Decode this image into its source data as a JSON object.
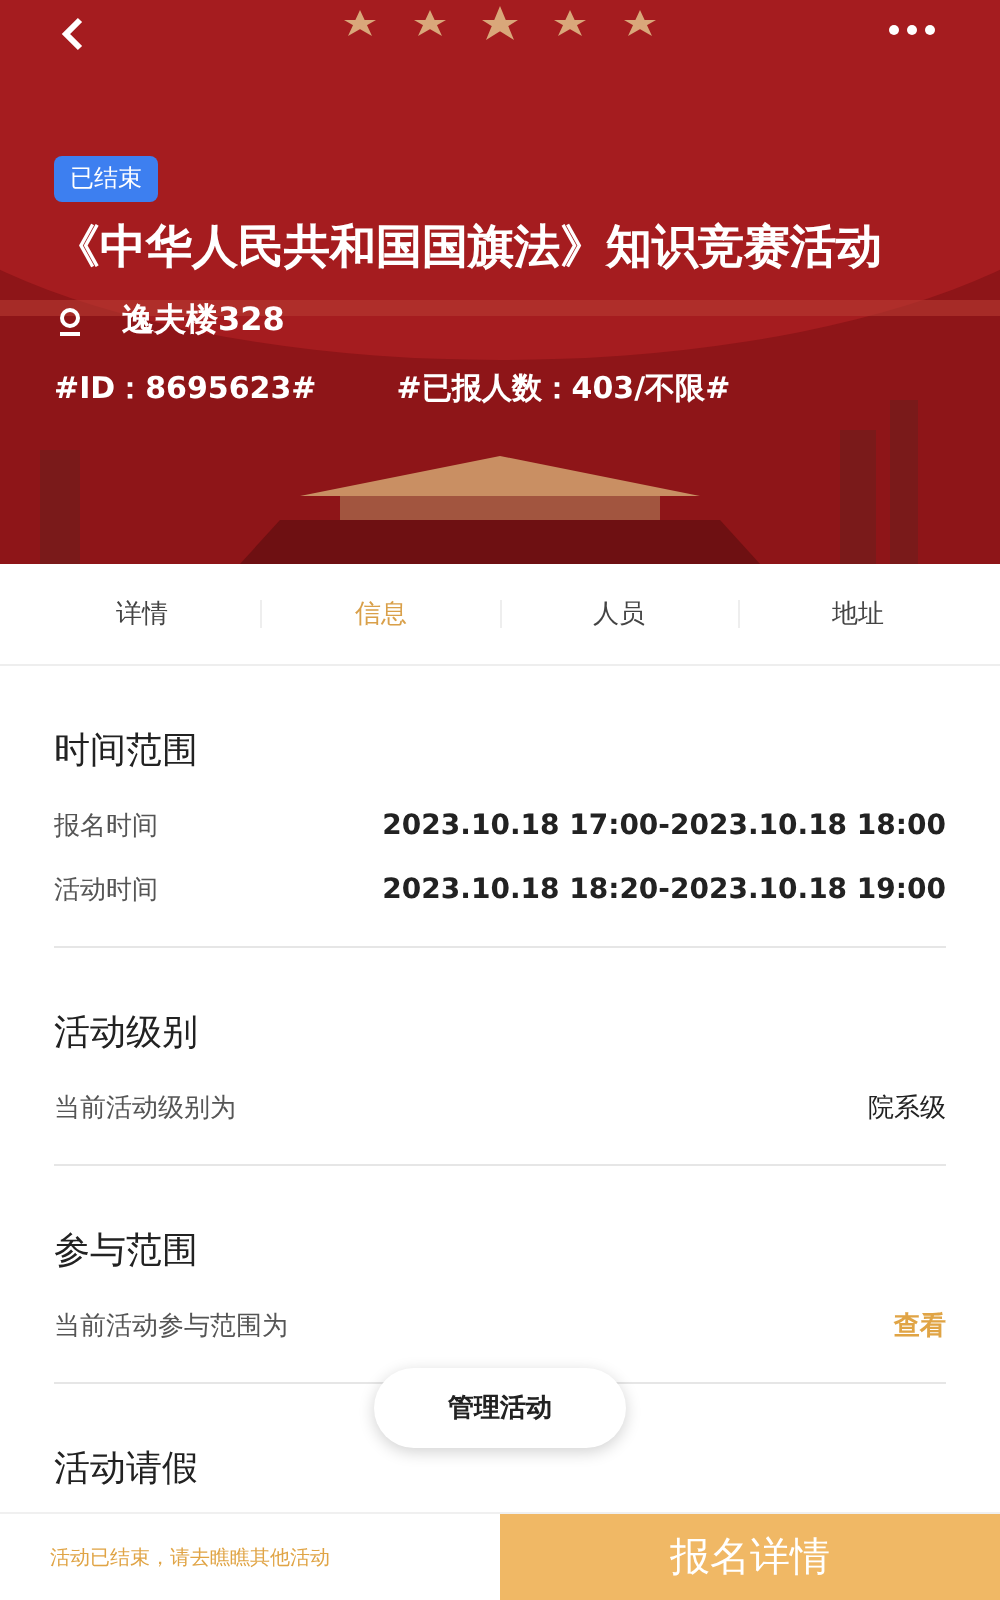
{
  "header": {
    "status": "已结束",
    "title": "《中华人民共和国国旗法》知识竞赛活动",
    "location": "逸夫楼328",
    "id_text": "#ID：8695623#",
    "count_text": "#已报人数：403/不限#"
  },
  "tabs": [
    {
      "label": "详情",
      "selected": false
    },
    {
      "label": "信息",
      "selected": true
    },
    {
      "label": "人员",
      "selected": false
    },
    {
      "label": "地址",
      "selected": false
    }
  ],
  "sections": [
    {
      "title": "时间范围",
      "rows": [
        {
          "label": "报名时间",
          "value": "2023.10.18 17:00-2023.10.18 18:00",
          "kind": "bold"
        },
        {
          "label": "活动时间",
          "value": "2023.10.18 18:20-2023.10.18 19:00",
          "kind": "bold"
        }
      ]
    },
    {
      "title": "活动级别",
      "rows": [
        {
          "label": "当前活动级别为",
          "value": "院系级",
          "kind": "plain"
        }
      ]
    },
    {
      "title": "参与范围",
      "rows": [
        {
          "label": "当前活动参与范围为",
          "value": "查看",
          "kind": "link"
        }
      ]
    },
    {
      "title": "活动请假"
    }
  ],
  "floating_button": "管理活动",
  "footer": {
    "notice": "活动已结束，请去瞧瞧其他活动",
    "button": "报名详情"
  }
}
